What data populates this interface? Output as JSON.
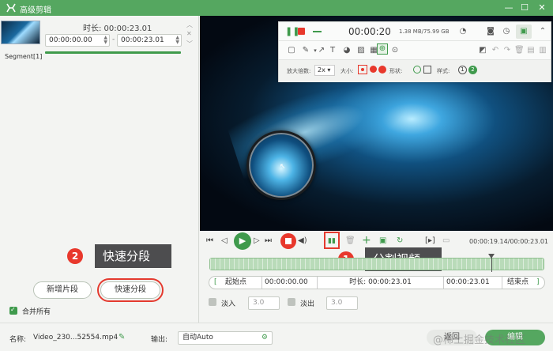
{
  "window": {
    "title": "高级剪辑",
    "minimize": "—",
    "maximize": "☐",
    "close": "✕"
  },
  "segment": {
    "duration_label": "时长: 00:00:23.01",
    "start": "00:00:00.00",
    "end": "00:00:23.01",
    "dash": "-",
    "name": "Segment[1]"
  },
  "left_buttons": {
    "add_segment": "新增片段",
    "quick_split": "快速分段"
  },
  "merge_all": {
    "label": "合并所有",
    "checked": true
  },
  "callouts": {
    "one": {
      "number": "1",
      "text": "分割视频"
    },
    "two": {
      "number": "2",
      "text": "快速分段"
    }
  },
  "recorder": {
    "timer": "00:00:20",
    "size": "1.38 MB/75.99 GB",
    "zoom_label": "放大倍数:",
    "zoom_value": "2x",
    "size_label": "大小:",
    "shape_label": "形状:",
    "style_label": "样式:",
    "style_1": "1",
    "style_2": "2"
  },
  "playback": {
    "time": "00:00:19.14/00:00:23.01"
  },
  "segment_row": {
    "start_btn": "起始点",
    "start_time": "00:00:00.00",
    "duration": "时长: 00:00:23.01",
    "end_time": "00:00:23.01",
    "end_btn": "结束点"
  },
  "fades": {
    "fade_in": "淡入",
    "fade_in_value": "3.0",
    "fade_out": "淡出",
    "fade_out_value": "3.0"
  },
  "bottom": {
    "name_label": "名称:",
    "file_name": "Video_230...52554.mp4",
    "output_label": "输出:",
    "output_value": "自动Auto",
    "back_btn": "返回",
    "edit_btn": "编辑",
    "watermark": "@稀土掘金技术社区"
  },
  "colors": {
    "accent": "#55a760",
    "highlight": "#e43a2f",
    "callout": "#4d4d4f"
  }
}
